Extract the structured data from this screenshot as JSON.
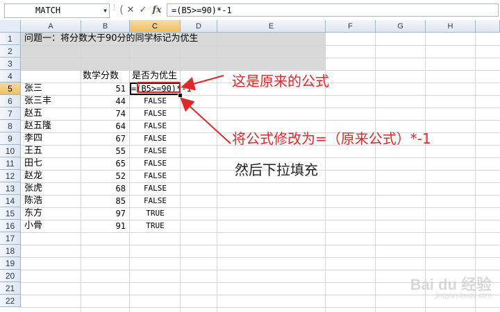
{
  "name_box": "MATCH",
  "formula_bar": {
    "cancel": "✕",
    "confirm": "✓",
    "fx": "fx",
    "formula": "=(B5>=90)*-1"
  },
  "columns": [
    "A",
    "B",
    "C",
    "D",
    "E",
    "F",
    "G",
    "H"
  ],
  "rows": [
    "1",
    "2",
    "3",
    "4",
    "5",
    "6",
    "7",
    "8",
    "9",
    "10",
    "11",
    "12",
    "13",
    "14",
    "15",
    "16",
    "17",
    "18",
    "19",
    "20",
    "21",
    "22"
  ],
  "title": "问题一：将分数大于90分的同学标记为优生",
  "headers": {
    "score": "数学分数",
    "excellent": "是否为优生"
  },
  "students": [
    {
      "name": "张三",
      "score": "51",
      "flag": ""
    },
    {
      "name": "张三丰",
      "score": "44",
      "flag": "FALSE"
    },
    {
      "name": "赵五",
      "score": "74",
      "flag": "FALSE"
    },
    {
      "name": "赵五隆",
      "score": "64",
      "flag": "FALSE"
    },
    {
      "name": "李四",
      "score": "67",
      "flag": "FALSE"
    },
    {
      "name": "王五",
      "score": "55",
      "flag": "FALSE"
    },
    {
      "name": "田七",
      "score": "65",
      "flag": "FALSE"
    },
    {
      "name": "赵龙",
      "score": "52",
      "flag": "FALSE"
    },
    {
      "name": "张虎",
      "score": "68",
      "flag": "FALSE"
    },
    {
      "name": "陈浩",
      "score": "85",
      "flag": "FALSE"
    },
    {
      "name": "东方",
      "score": "97",
      "flag": "TRUE"
    },
    {
      "name": "小骨",
      "score": "91",
      "flag": "TRUE"
    }
  ],
  "editing_cell": "=(B5>=90)*-1",
  "annotations": {
    "original": "这是原来的公式",
    "modify": "将公式修改为=（原来公式）*-1",
    "fill": "然后下拉填充"
  },
  "watermark": {
    "main": "Bai du 经验",
    "sub": "jingyan.baidu.com"
  },
  "colors": {
    "annotation": "#e02828",
    "selected_header": "#f1c15f"
  }
}
